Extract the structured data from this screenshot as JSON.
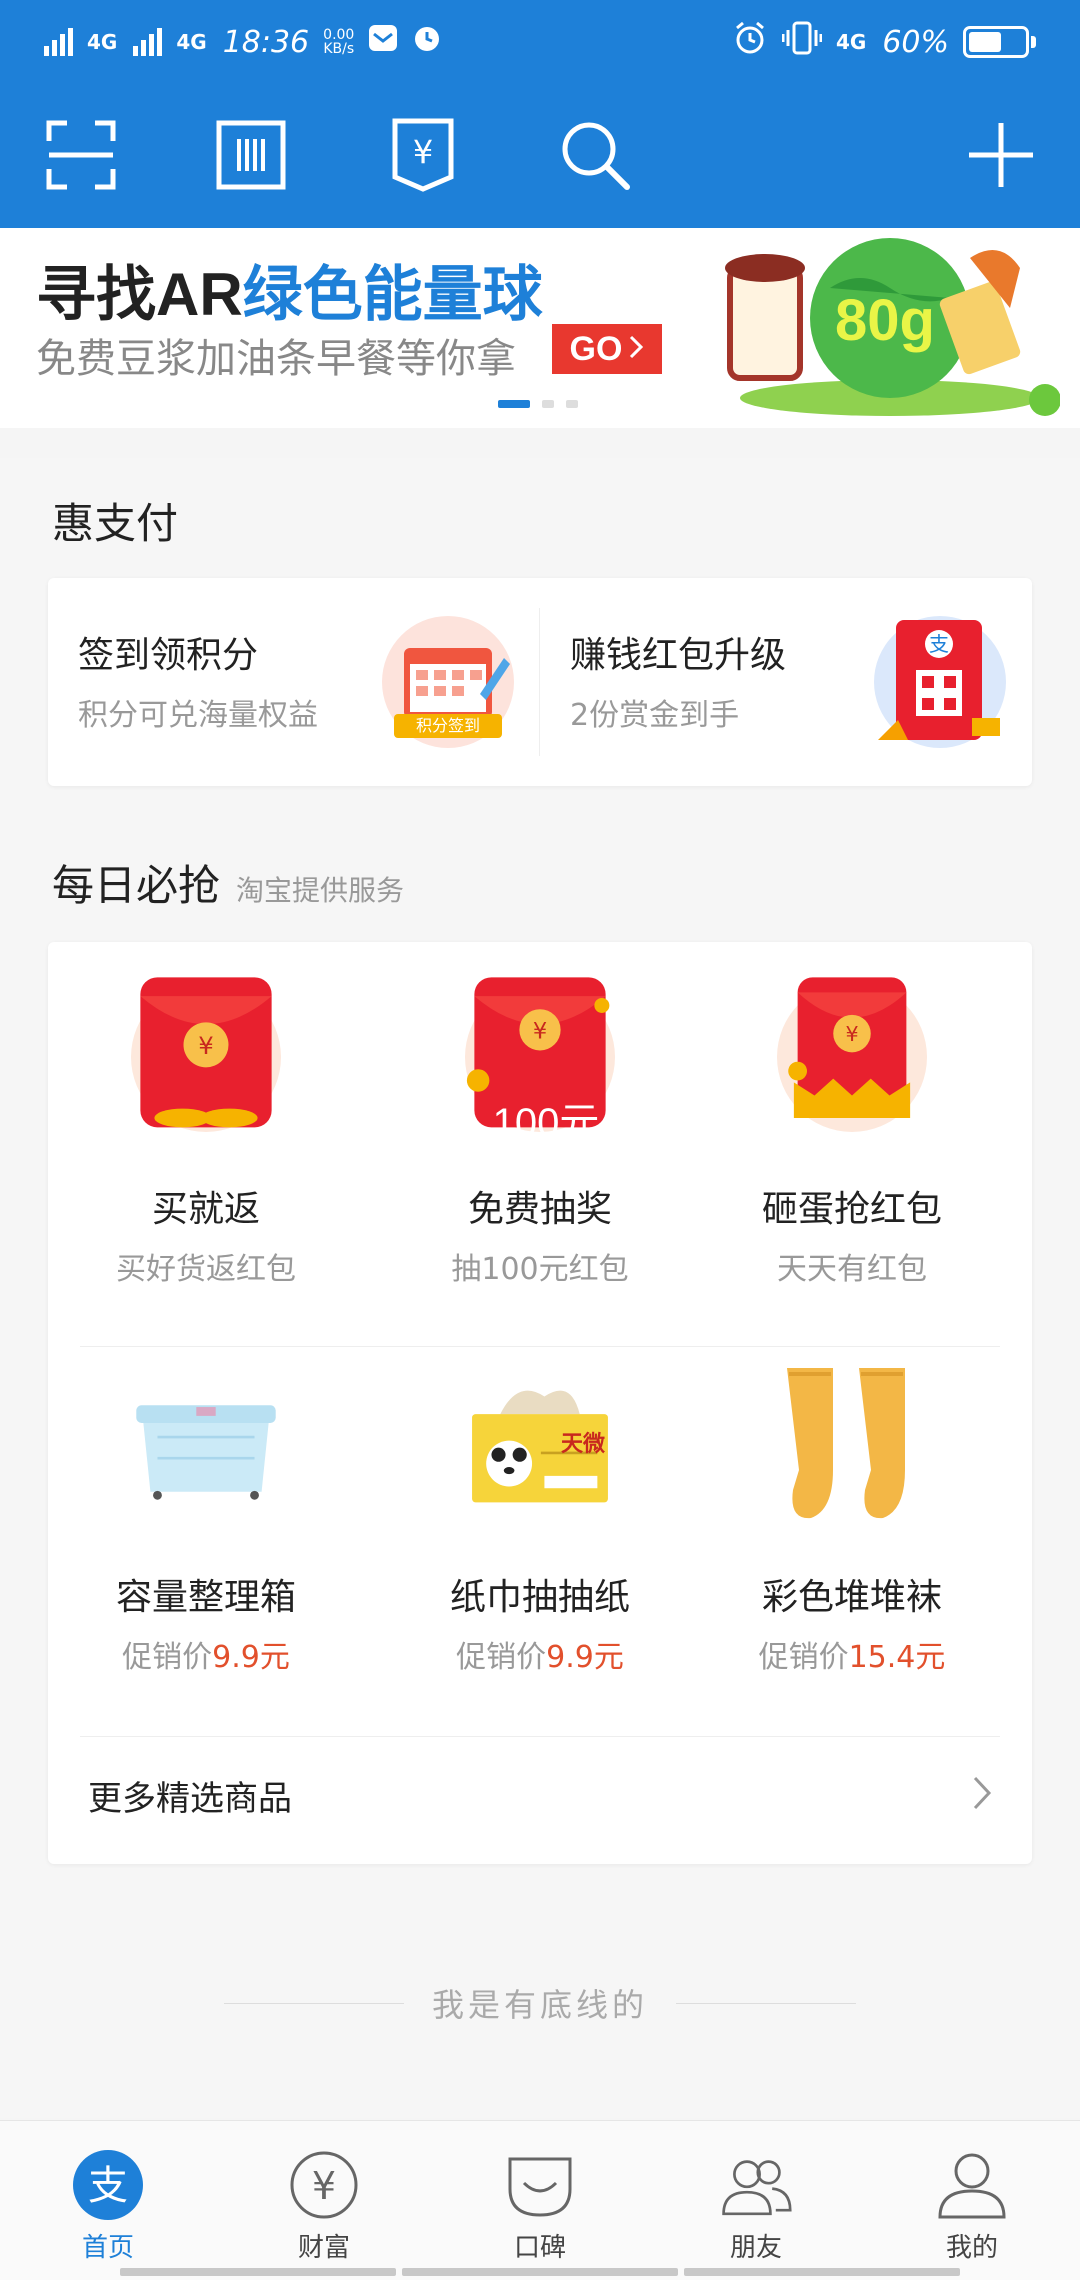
{
  "status_bar": {
    "net1": "4G",
    "net2": "4G",
    "time": "18:36",
    "speed_value": "0.00",
    "speed_unit": "KB/s",
    "net3": "4G",
    "battery": "60%",
    "battery_level": 0.6
  },
  "toolbar": {
    "icons": [
      "scan-icon",
      "barcode-icon",
      "pay-code-icon",
      "search-icon",
      "add-icon"
    ]
  },
  "banner": {
    "title_part1": "寻找AR",
    "title_part2": "绿色能量球",
    "subtitle": "免费豆浆加油条早餐等你拿",
    "go_label": "GO",
    "art_label": "80g",
    "pages": 3,
    "active_page": 1
  },
  "huizhifu": {
    "title": "惠支付",
    "items": [
      {
        "title": "签到领积分",
        "desc": "积分可兑海量权益",
        "badge": "积分签到"
      },
      {
        "title": "赚钱红包升级",
        "desc": "2份赏金到手",
        "badge": "支"
      }
    ]
  },
  "daily": {
    "title": "每日必抢",
    "subtitle": "淘宝提供服务",
    "row1": [
      {
        "name": "买就返",
        "sub": "买好货返红包"
      },
      {
        "name": "免费抽奖",
        "sub": "抽100元红包",
        "badge": "100元"
      },
      {
        "name": "砸蛋抢红包",
        "sub": "天天有红包"
      }
    ],
    "row2": [
      {
        "name": "容量整理箱",
        "price_prefix": "促销价",
        "price": "9.9元"
      },
      {
        "name": "纸巾抽抽纸",
        "price_prefix": "促销价",
        "price": "9.9元",
        "brand": "天微"
      },
      {
        "name": "彩色堆堆袜",
        "price_prefix": "促销价",
        "price": "15.4元"
      }
    ],
    "more_label": "更多精选商品"
  },
  "footer_text": "我是有底线的",
  "tabs": [
    {
      "label": "首页",
      "icon": "home-alipay-icon",
      "active": true
    },
    {
      "label": "财富",
      "icon": "wealth-yen-icon"
    },
    {
      "label": "口碑",
      "icon": "koubei-icon"
    },
    {
      "label": "朋友",
      "icon": "friends-icon"
    },
    {
      "label": "我的",
      "icon": "profile-icon"
    }
  ],
  "colors": {
    "brand_blue": "#1e80d8",
    "price_red": "#e2502c",
    "go_red": "#e8382f"
  }
}
